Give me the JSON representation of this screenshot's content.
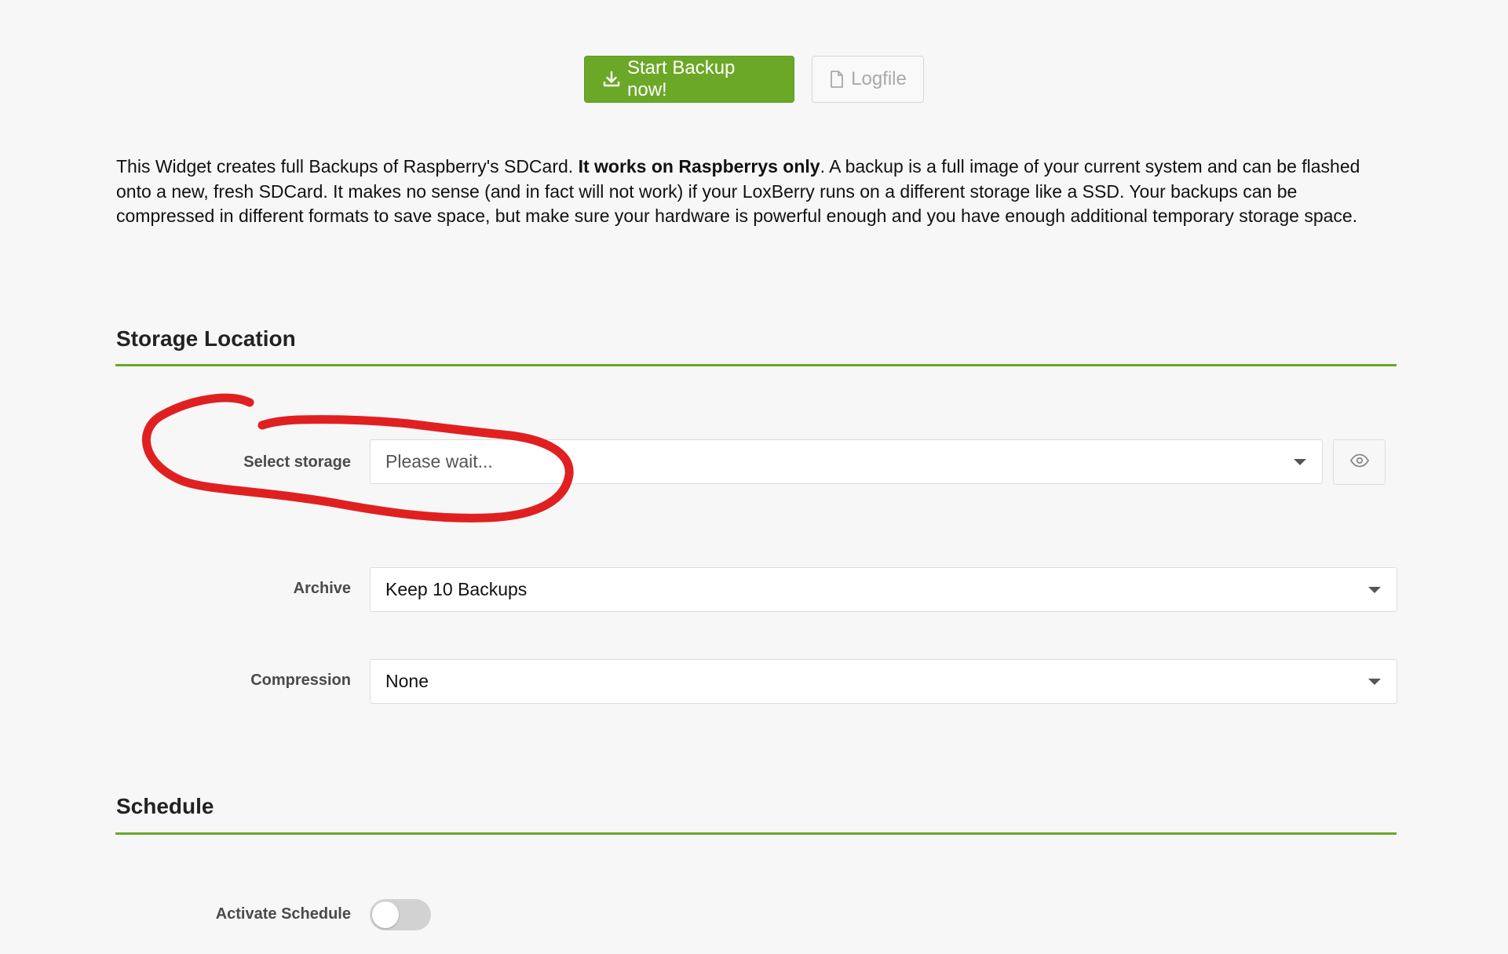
{
  "toolbar": {
    "start_backup_label": "Start Backup now!",
    "logfile_label": "Logfile"
  },
  "description": {
    "part1": "This Widget creates full Backups of Raspberry's SDCard. ",
    "bold": "It works on Raspberrys only",
    "part2": ". A backup is a full image of your current system and can be flashed onto a new, fresh SDCard. It makes no sense (and in fact will not work) if your LoxBerry runs on a different storage like a SSD. Your backups can be compressed in different formats to save space, but make sure your hardware is powerful enough and you have enough additional temporary storage space."
  },
  "storage_location": {
    "title": "Storage Location",
    "select_storage": {
      "label": "Select storage",
      "value": "Please wait..."
    },
    "archive": {
      "label": "Archive",
      "value": "Keep 10 Backups"
    },
    "compression": {
      "label": "Compression",
      "value": "None"
    }
  },
  "schedule": {
    "title": "Schedule",
    "activate": {
      "label": "Activate Schedule",
      "enabled": false
    }
  },
  "icons": {
    "start_backup": "download-icon",
    "logfile": "file-icon",
    "show": "eye-icon"
  },
  "colors": {
    "accent": "#6ba827",
    "annotation": "#e02020"
  }
}
